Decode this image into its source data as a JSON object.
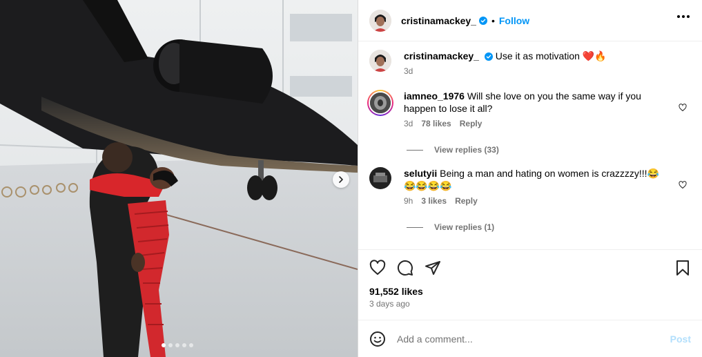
{
  "post": {
    "username": "cristinamackey_",
    "follow_label": "Follow",
    "separator": "•",
    "caption": "Use it as motivation ❤️🔥",
    "caption_age": "3d",
    "likes": "91,552 likes",
    "date": "3 days ago",
    "media": {
      "slide_count": 5,
      "active_slide": 1
    }
  },
  "comments": [
    {
      "username": "iamneo_1976",
      "text": "Will she love on you the same way if you happen to lose it all?",
      "age": "3d",
      "likes": "78 likes",
      "reply_label": "Reply",
      "view_replies": "View replies (33)"
    },
    {
      "username": "selutyii",
      "text": "Being a man and hating on women is crazzzzy!!!😂😂😂😂😂",
      "age": "9h",
      "likes": "3 likes",
      "reply_label": "Reply",
      "view_replies": "View replies (1)"
    }
  ],
  "composer": {
    "placeholder": "Add a comment...",
    "post_label": "Post"
  },
  "colors": {
    "accent": "#0095f6",
    "muted": "#737373",
    "post_disabled": "#b2dffc"
  }
}
